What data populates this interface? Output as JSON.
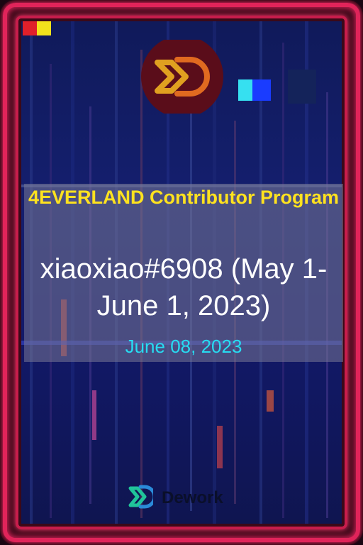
{
  "card": {
    "title": "4EVERLAND Contributor Program",
    "recipient": "xiaoxiao#6908 (May 1-June 1, 2023)",
    "date": "June 08, 2023",
    "brand": "Dework"
  },
  "colors": {
    "frame": "#e0245a",
    "title": "#ffe21f",
    "name": "#ffffff",
    "date": "#27dcf2",
    "background": "#141f6e"
  },
  "icons": [
    "dework-logo-icon",
    "dework-brand-icon"
  ]
}
